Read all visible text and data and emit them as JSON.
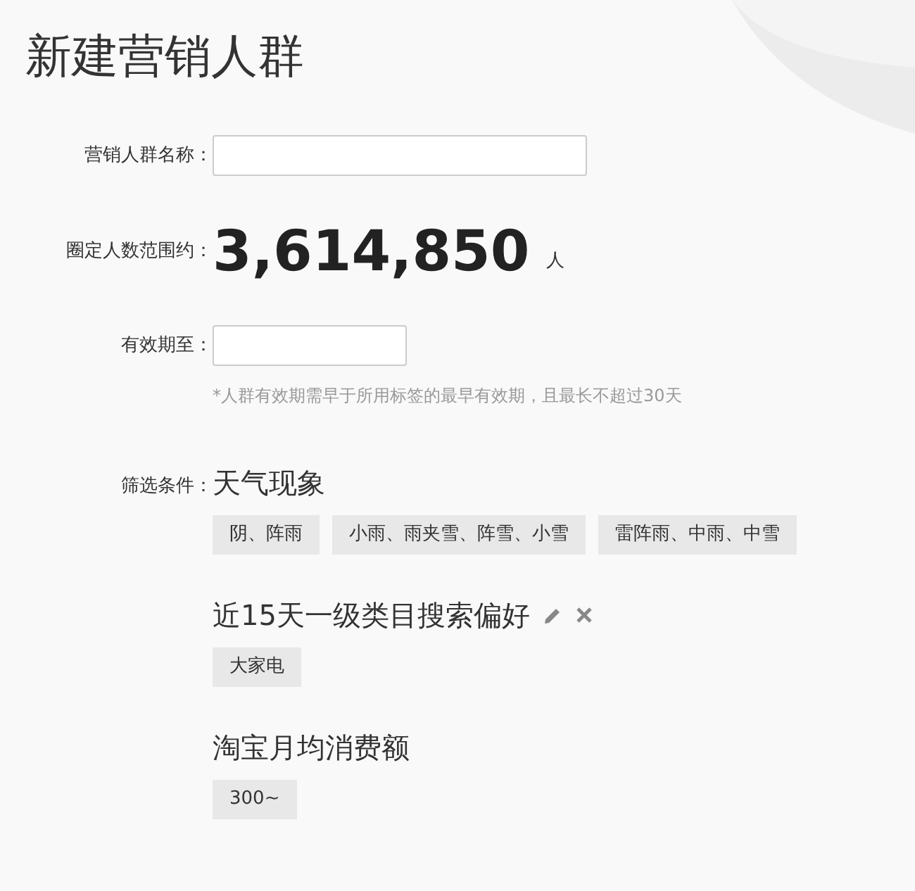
{
  "title": "新建营销人群",
  "name_field": {
    "label": "营销人群名称："
  },
  "count": {
    "label": "圈定人数范围约：",
    "value": "3,614,850",
    "unit": "人"
  },
  "expiry_field": {
    "label": "有效期至：",
    "hint": "*人群有效期需早于所用标签的最早有效期，且最长不超过30天"
  },
  "filters": {
    "label": "筛选条件：",
    "groups": [
      {
        "title": "天气现象",
        "editable": false,
        "tags": [
          "阴、阵雨",
          "小雨、雨夹雪、阵雪、小雪",
          "雷阵雨、中雨、中雪"
        ]
      },
      {
        "title": "近15天一级类目搜索偏好",
        "editable": true,
        "tags": [
          "大家电"
        ]
      },
      {
        "title": "淘宝月均消费额",
        "editable": false,
        "tags": [
          "300~"
        ]
      }
    ]
  }
}
